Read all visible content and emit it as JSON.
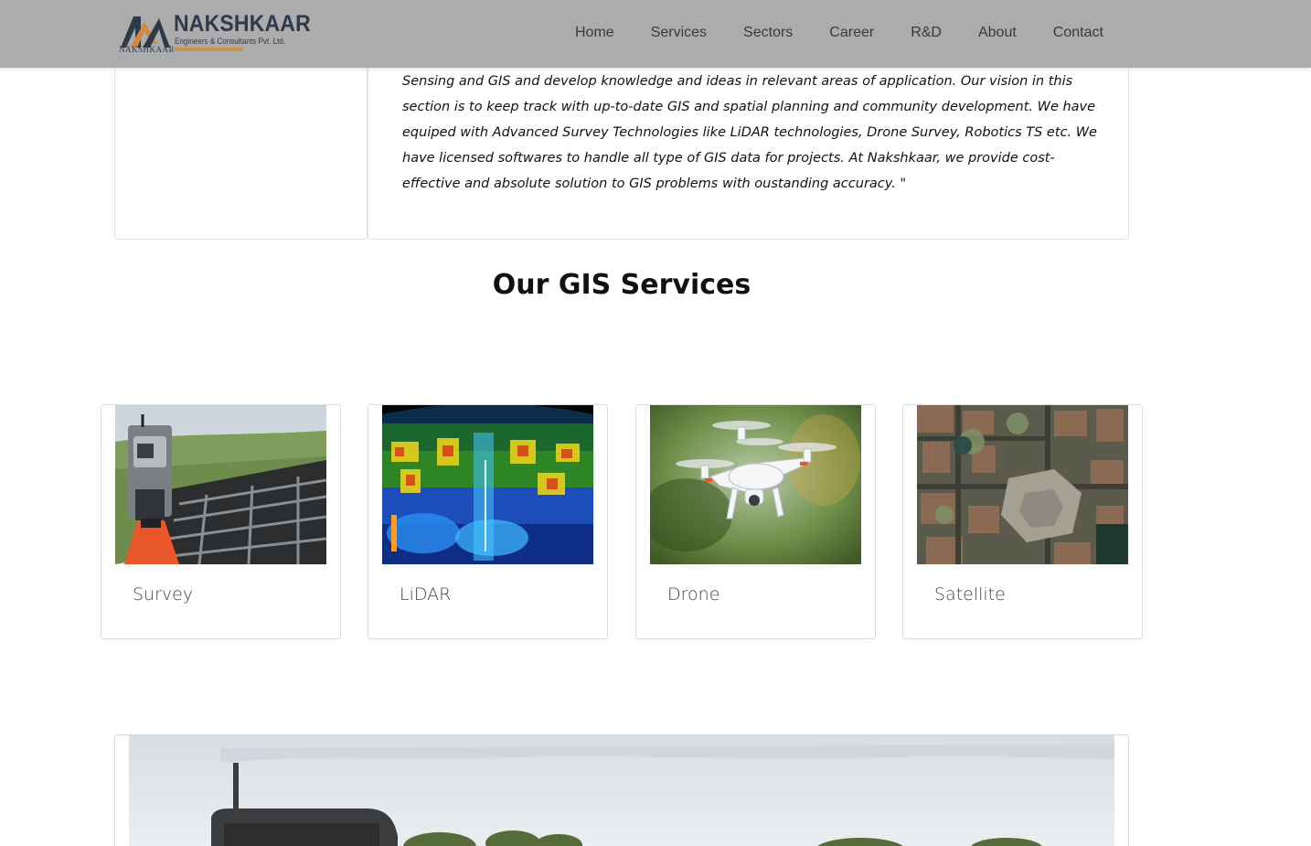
{
  "header": {
    "logo": {
      "name": "NAKSHKAAR",
      "subtitle": "Engineers & Consultants Pvt. Ltd.",
      "small_name": "NAKSHKAAR"
    },
    "nav": [
      {
        "label": "Home"
      },
      {
        "label": "Services"
      },
      {
        "label": "Sectors"
      },
      {
        "label": "Career"
      },
      {
        "label": "R&D"
      },
      {
        "label": "About"
      },
      {
        "label": "Contact"
      }
    ]
  },
  "intro": {
    "quote": "Sensing and GIS and develop knowledge and ideas in relevant areas of application. Our vision in this section is to keep track with up-to-date GIS and spatial planning and community development. We have equiped with Advanced Survey Technologies like LiDAR technologies, Drone Survey, Robotics TS etc. We have licensed softwares to handle all type of GIS data for projects. At Nakshkaar, we provide cost-effective and absolute solution to GIS problems with oustanding accuracy. \""
  },
  "section": {
    "title_prefix": "Our",
    "title_bold": "GIS Services"
  },
  "services": [
    {
      "label": "Survey",
      "image": "total-station-survey-photo"
    },
    {
      "label": "LiDAR",
      "image": "lidar-point-cloud-city-photo"
    },
    {
      "label": "Drone",
      "image": "white-quadcopter-drone-photo"
    },
    {
      "label": "Satellite",
      "image": "satellite-city-aerial-photo"
    }
  ],
  "colors": {
    "header_bg": "#acacac",
    "logo_dark": "#2e3a4a",
    "logo_accent": "#d48a3a",
    "border": "#dcdcdc"
  }
}
